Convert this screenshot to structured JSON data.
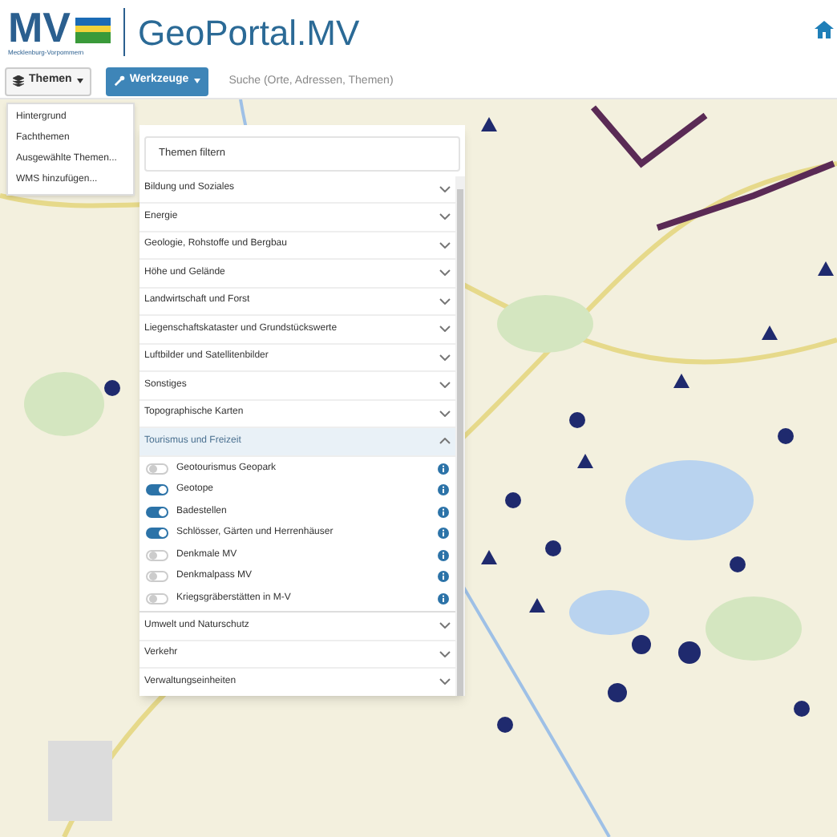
{
  "header": {
    "logo_text": "MV",
    "logo_subtitle": "Mecklenburg-Vorpommern",
    "title": "GeoPortal.MV"
  },
  "toolbar": {
    "themes_button": "Themen",
    "tools_button": "Werkzeuge",
    "search": {
      "placeholder": "Suche (Orte, Adressen, Themen)"
    }
  },
  "themes_menu": [
    "Hintergrund",
    "Fachthemen",
    "Ausgewählte Themen...",
    "WMS hinzufügen..."
  ],
  "panel": {
    "filter": {
      "placeholder": "Themen filtern"
    },
    "categories": [
      {
        "label": "Bildung und Soziales",
        "expanded": false
      },
      {
        "label": "Energie",
        "expanded": false
      },
      {
        "label": "Geologie, Rohstoffe und Bergbau",
        "expanded": false
      },
      {
        "label": "Höhe und Gelände",
        "expanded": false
      },
      {
        "label": "Landwirtschaft und Forst",
        "expanded": false
      },
      {
        "label": "Liegenschaftskataster und Grundstückswerte",
        "expanded": false
      },
      {
        "label": "Luftbilder und Satellitenbilder",
        "expanded": false
      },
      {
        "label": "Sonstiges",
        "expanded": false
      },
      {
        "label": "Topographische Karten",
        "expanded": false
      },
      {
        "label": "Tourismus und Freizeit",
        "expanded": true,
        "layers": [
          {
            "label": "Geotourismus Geopark",
            "on": false
          },
          {
            "label": "Geotope",
            "on": true
          },
          {
            "label": "Badestellen",
            "on": true
          },
          {
            "label": "Schlösser, Gärten und Herrenhäuser",
            "on": true
          },
          {
            "label": "Denkmale MV",
            "on": false
          },
          {
            "label": "Denkmalpass MV",
            "on": false
          },
          {
            "label": "Kriegsgräberstätten in M-V",
            "on": false
          }
        ]
      },
      {
        "label": "Umwelt und Naturschutz",
        "expanded": false
      },
      {
        "label": "Verkehr",
        "expanded": false
      },
      {
        "label": "Verwaltungseinheiten",
        "expanded": false
      }
    ]
  }
}
